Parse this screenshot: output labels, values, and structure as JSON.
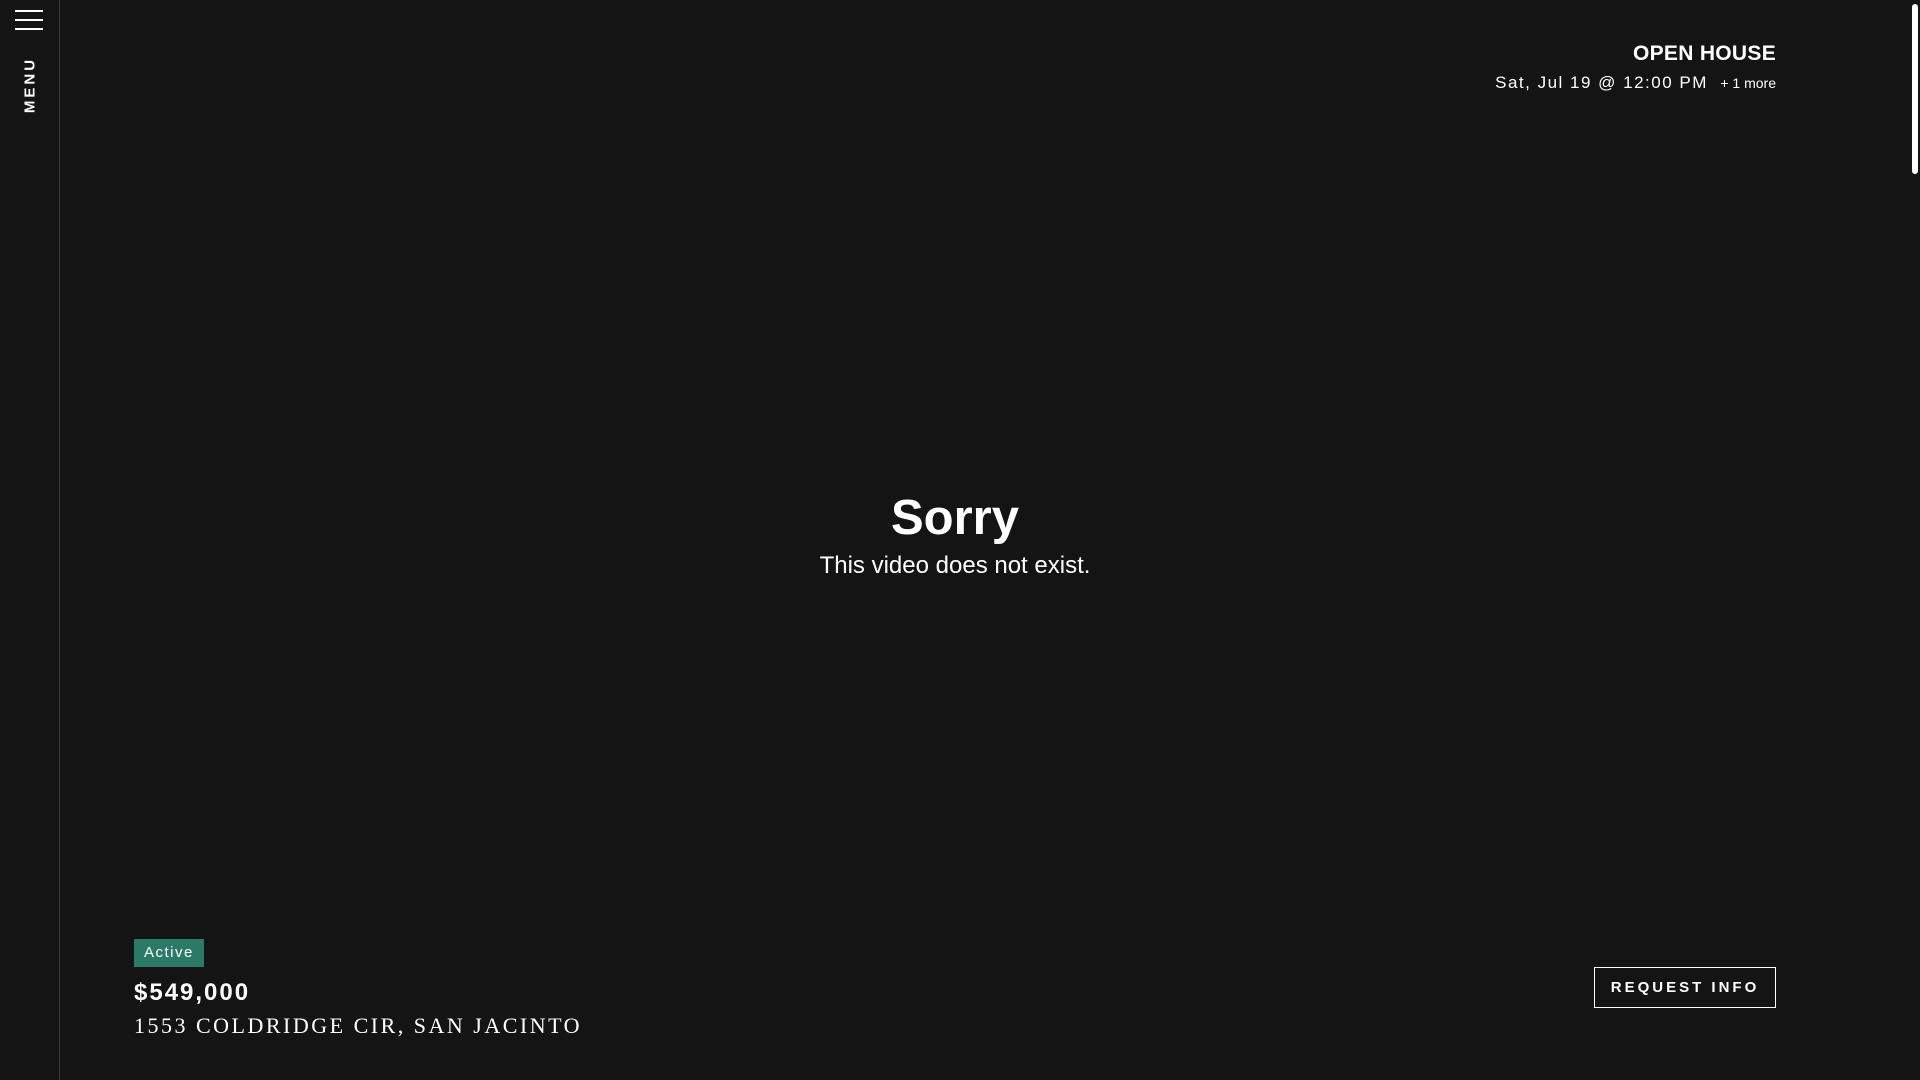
{
  "sidebar": {
    "menu_icon": "hamburger-menu-icon",
    "menu_label": "MENU"
  },
  "open_house": {
    "title": "OPEN HOUSE",
    "date": "Sat, Jul 19 @ 12:00 PM",
    "more": "+ 1 more"
  },
  "video_error": {
    "title": "Sorry",
    "message": "This video does not exist."
  },
  "listing": {
    "status": "Active",
    "status_color": "#2a7a67",
    "price": "$549,000",
    "address": "1553 COLDRIDGE CIR, SAN JACINTO"
  },
  "actions": {
    "request_info_label": "REQUEST INFO"
  },
  "colors": {
    "background": "#141414",
    "text": "#ffffff",
    "accent": "#2a7a67"
  }
}
